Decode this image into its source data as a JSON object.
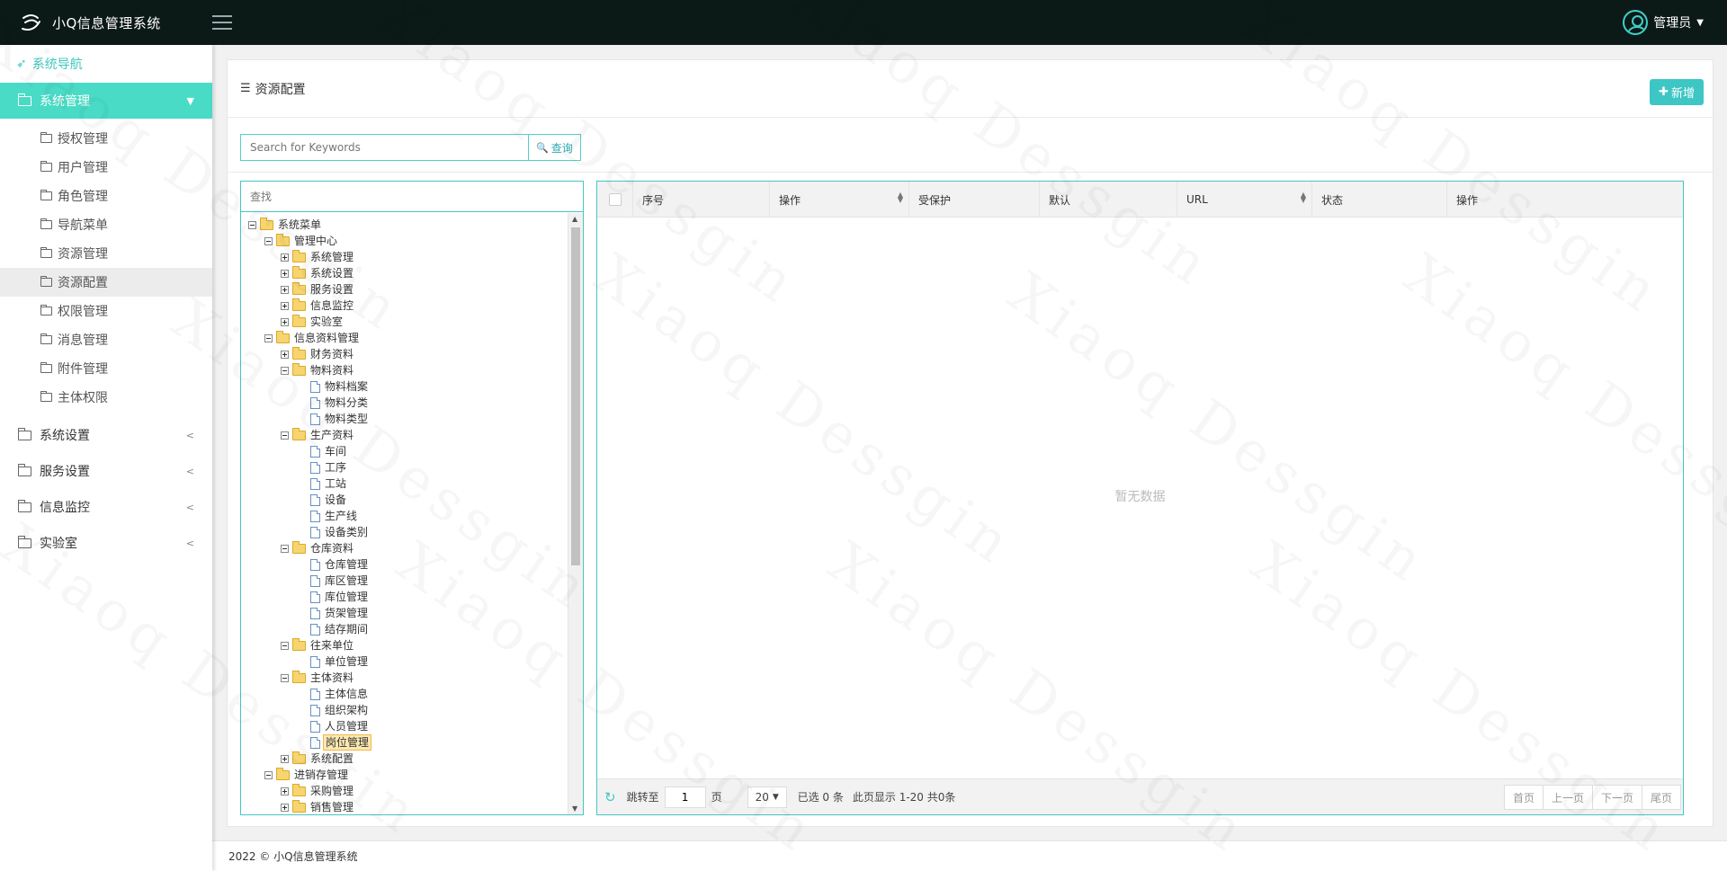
{
  "app": {
    "title": "小Q信息管理系统"
  },
  "header": {
    "user_name": "管理员"
  },
  "sidebar": {
    "nav_title": "系统导航",
    "active_group": "系统管理",
    "sub_items": [
      "授权管理",
      "用户管理",
      "角色管理",
      "导航菜单",
      "资源管理",
      "资源配置",
      "权限管理",
      "消息管理",
      "附件管理",
      "主体权限"
    ],
    "selected_sub": "资源配置",
    "groups": [
      "系统设置",
      "服务设置",
      "信息监控",
      "实验室"
    ]
  },
  "panel": {
    "title": "资源配置",
    "add_label": "新增",
    "search_placeholder": "Search for Keywords",
    "search_label": "查询"
  },
  "tree": {
    "search_placeholder": "查找",
    "nodes": [
      {
        "level": 0,
        "type": "folder",
        "toggle": "minus",
        "label": "系统菜单"
      },
      {
        "level": 1,
        "type": "folder",
        "toggle": "minus",
        "label": "管理中心"
      },
      {
        "level": 2,
        "type": "folder",
        "toggle": "plus",
        "label": "系统管理"
      },
      {
        "level": 2,
        "type": "folder",
        "toggle": "plus",
        "label": "系统设置"
      },
      {
        "level": 2,
        "type": "folder",
        "toggle": "plus",
        "label": "服务设置"
      },
      {
        "level": 2,
        "type": "folder",
        "toggle": "plus",
        "label": "信息监控"
      },
      {
        "level": 2,
        "type": "folder",
        "toggle": "plus",
        "label": "实验室"
      },
      {
        "level": 1,
        "type": "folder",
        "toggle": "minus",
        "label": "信息资料管理"
      },
      {
        "level": 2,
        "type": "folder",
        "toggle": "plus",
        "label": "财务资料"
      },
      {
        "level": 2,
        "type": "folder",
        "toggle": "minus",
        "label": "物料资料"
      },
      {
        "level": 3,
        "type": "doc",
        "label": "物料档案"
      },
      {
        "level": 3,
        "type": "doc",
        "label": "物料分类"
      },
      {
        "level": 3,
        "type": "doc",
        "label": "物料类型"
      },
      {
        "level": 2,
        "type": "folder",
        "toggle": "minus",
        "label": "生产资料"
      },
      {
        "level": 3,
        "type": "doc",
        "label": "车间"
      },
      {
        "level": 3,
        "type": "doc",
        "label": "工序"
      },
      {
        "level": 3,
        "type": "doc",
        "label": "工站"
      },
      {
        "level": 3,
        "type": "doc",
        "label": "设备"
      },
      {
        "level": 3,
        "type": "doc",
        "label": "生产线"
      },
      {
        "level": 3,
        "type": "doc",
        "label": "设备类别"
      },
      {
        "level": 2,
        "type": "folder",
        "toggle": "minus",
        "label": "仓库资料"
      },
      {
        "level": 3,
        "type": "doc",
        "label": "仓库管理"
      },
      {
        "level": 3,
        "type": "doc",
        "label": "库区管理"
      },
      {
        "level": 3,
        "type": "doc",
        "label": "库位管理"
      },
      {
        "level": 3,
        "type": "doc",
        "label": "货架管理"
      },
      {
        "level": 3,
        "type": "doc",
        "label": "结存期间"
      },
      {
        "level": 2,
        "type": "folder",
        "toggle": "minus",
        "label": "往来单位"
      },
      {
        "level": 3,
        "type": "doc",
        "label": "单位管理"
      },
      {
        "level": 2,
        "type": "folder",
        "toggle": "minus",
        "label": "主体资料"
      },
      {
        "level": 3,
        "type": "doc",
        "label": "主体信息"
      },
      {
        "level": 3,
        "type": "doc",
        "label": "组织架构"
      },
      {
        "level": 3,
        "type": "doc",
        "label": "人员管理"
      },
      {
        "level": 3,
        "type": "doc",
        "label": "岗位管理",
        "highlight": true
      },
      {
        "level": 2,
        "type": "folder",
        "toggle": "plus",
        "label": "系统配置"
      },
      {
        "level": 1,
        "type": "folder",
        "toggle": "minus",
        "label": "进销存管理"
      },
      {
        "level": 2,
        "type": "folder",
        "toggle": "plus",
        "label": "采购管理"
      },
      {
        "level": 2,
        "type": "folder",
        "toggle": "plus",
        "label": "销售管理"
      }
    ]
  },
  "grid": {
    "columns": [
      {
        "label": "序号",
        "sortable": false
      },
      {
        "label": "操作",
        "sortable": true
      },
      {
        "label": "受保护",
        "sortable": false
      },
      {
        "label": "默认",
        "sortable": false
      },
      {
        "label": "URL",
        "sortable": true
      },
      {
        "label": "状态",
        "sortable": false
      },
      {
        "label": "操作",
        "sortable": false
      }
    ],
    "empty_text": "暂无数据"
  },
  "pager": {
    "jump_label": "跳转至",
    "page_value": "1",
    "page_unit": "页",
    "page_size": "20",
    "selected_text": "已选 0 条",
    "range_text": "此页显示 1-20 共0条",
    "first": "首页",
    "prev": "上一页",
    "next": "下一页",
    "last": "尾页"
  },
  "footer": {
    "text": "2022 © 小Q信息管理系统"
  },
  "watermark": "Xiaoq Dessgin",
  "colors": {
    "accent": "#49dbc5",
    "header_bg": "#0c1a17",
    "button": "#3dc6c4"
  }
}
